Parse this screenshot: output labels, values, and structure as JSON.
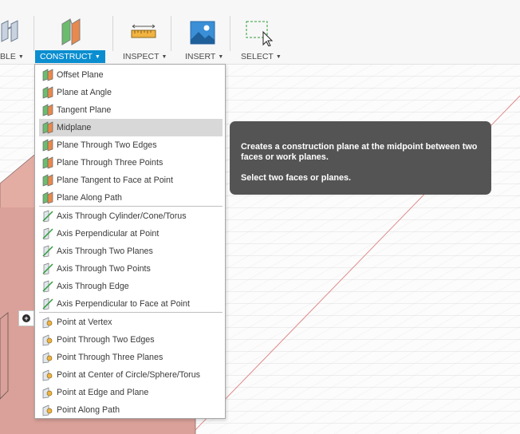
{
  "toolbar": {
    "groups": [
      {
        "label": "BLE",
        "icon": "assemble-icon"
      },
      {
        "label": "CONSTRUCT",
        "icon": "construct-plane-icon",
        "active": true
      },
      {
        "label": "INSPECT",
        "icon": "measure-ruler-icon"
      },
      {
        "label": "INSERT",
        "icon": "insert-image-icon"
      },
      {
        "label": "SELECT",
        "icon": "select-window-icon"
      }
    ]
  },
  "construct_menu": {
    "items": [
      {
        "label": "Offset Plane",
        "icon": "offset-plane-icon"
      },
      {
        "label": "Plane at Angle",
        "icon": "plane-at-angle-icon"
      },
      {
        "label": "Tangent Plane",
        "icon": "tangent-plane-icon"
      },
      {
        "label": "Midplane",
        "icon": "midplane-icon",
        "highlighted": true
      },
      {
        "label": "Plane Through Two Edges",
        "icon": "plane-two-edges-icon"
      },
      {
        "label": "Plane Through Three Points",
        "icon": "plane-three-points-icon"
      },
      {
        "label": "Plane Tangent to Face at Point",
        "icon": "plane-tangent-face-point-icon"
      },
      {
        "label": "Plane Along Path",
        "icon": "plane-along-path-icon"
      },
      {
        "label": "Axis Through Cylinder/Cone/Torus",
        "icon": "axis-cylinder-icon"
      },
      {
        "label": "Axis Perpendicular at Point",
        "icon": "axis-perpendicular-point-icon"
      },
      {
        "label": "Axis Through Two Planes",
        "icon": "axis-two-planes-icon"
      },
      {
        "label": "Axis Through Two Points",
        "icon": "axis-two-points-icon"
      },
      {
        "label": "Axis Through Edge",
        "icon": "axis-edge-icon"
      },
      {
        "label": "Axis Perpendicular to Face at Point",
        "icon": "axis-perpendicular-face-icon"
      },
      {
        "label": "Point at Vertex",
        "icon": "point-vertex-icon"
      },
      {
        "label": "Point Through Two Edges",
        "icon": "point-two-edges-icon"
      },
      {
        "label": "Point Through Three Planes",
        "icon": "point-three-planes-icon"
      },
      {
        "label": "Point at Center of Circle/Sphere/Torus",
        "icon": "point-center-icon"
      },
      {
        "label": "Point at Edge and Plane",
        "icon": "point-edge-plane-icon"
      },
      {
        "label": "Point Along Path",
        "icon": "point-along-path-icon"
      }
    ]
  },
  "tooltip": {
    "line1": "Creates a construction plane at the midpoint between two faces or work planes.",
    "line2": "Select two faces or planes."
  },
  "viewport": {
    "marker_icon": "add-circle-icon"
  },
  "colors": {
    "accent": "#0a8ed0",
    "body_fill": "#d9a199",
    "tooltip_bg": "#545454"
  }
}
